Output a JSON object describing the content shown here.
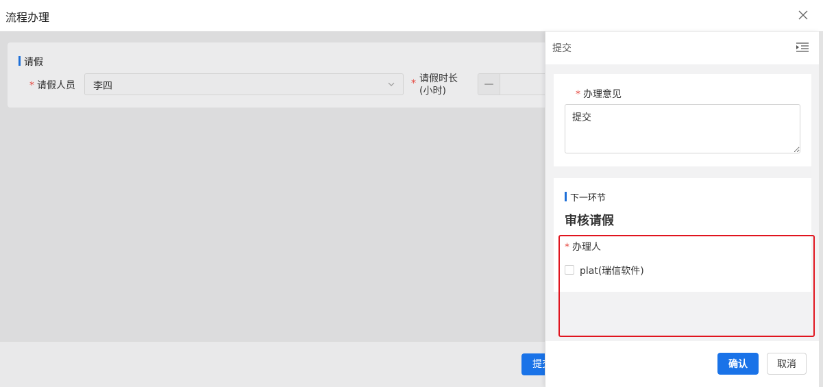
{
  "window": {
    "title": "流程办理",
    "close_icon": "close-icon"
  },
  "form": {
    "section_title": "请假",
    "person": {
      "label": "请假人员",
      "value": "李四"
    },
    "duration": {
      "label_line1": "请假时长",
      "label_line2": "(小时)",
      "minus": "—"
    }
  },
  "footer": {
    "submit_label": "提交"
  },
  "drawer": {
    "title": "提交",
    "opinion": {
      "label": "办理意见",
      "value": "提交"
    },
    "next_step": {
      "section_title": "下一环节",
      "node_name": "审核请假",
      "handler_label": "办理人",
      "handlers": [
        {
          "label": "plat(瑞信软件)",
          "checked": false
        }
      ]
    },
    "confirm_label": "确认",
    "cancel_label": "取消"
  },
  "colors": {
    "primary": "#1a73e8",
    "required": "#e5483f",
    "highlight": "#e0141e"
  }
}
